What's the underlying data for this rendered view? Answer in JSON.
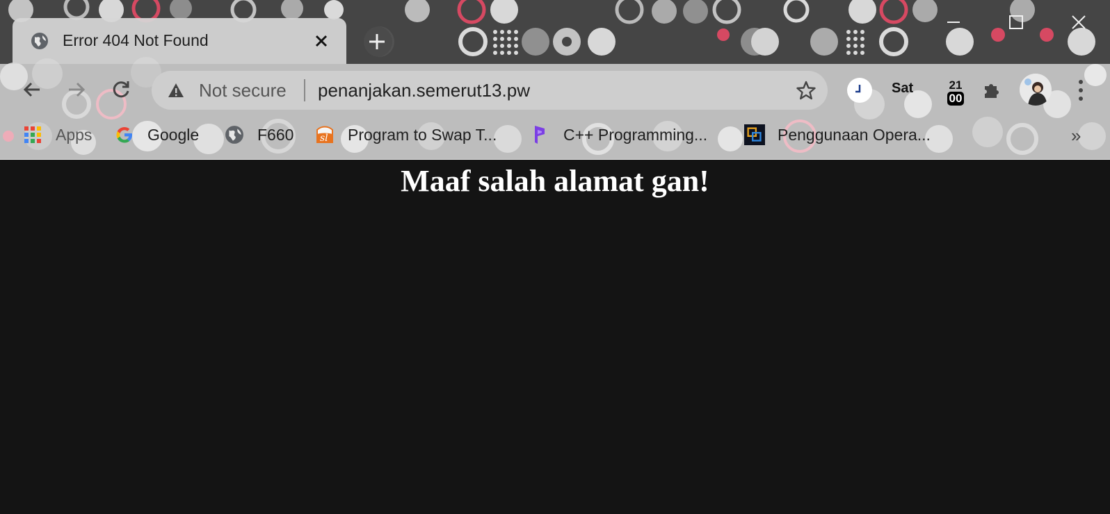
{
  "window": {
    "icons": {
      "minimize": "minimize-icon",
      "maximize": "maximize-icon",
      "close": "close-icon"
    }
  },
  "tab": {
    "title": "Error 404 Not Found",
    "favicon": "globe-icon",
    "close_icon": "close-icon"
  },
  "new_tab_icon": "plus-icon",
  "nav": {
    "back_icon": "back-arrow-icon",
    "forward_icon": "forward-arrow-icon",
    "reload_icon": "reload-icon"
  },
  "omnibox": {
    "security_icon": "warning-triangle-icon",
    "security_label": "Not secure",
    "url": "penanjakan.semerut13.pw",
    "bookmark_icon": "star-icon"
  },
  "extensions": {
    "clock_icon": "clock-icon",
    "day": "Sat",
    "date_number": "21",
    "date_box": "00",
    "puzzle_icon": "puzzle-icon",
    "avatar": "profile-avatar",
    "menu_icon": "three-dots-icon"
  },
  "bookmarks": [
    {
      "label": "Apps",
      "icon": "apps-grid-icon"
    },
    {
      "label": "Google",
      "icon": "google-icon"
    },
    {
      "label": "F660",
      "icon": "globe-icon"
    },
    {
      "label": "Program to Swap T...",
      "icon": "sl-logo-icon"
    },
    {
      "label": "C++ Programming...",
      "icon": "p-logo-icon"
    },
    {
      "label": "Penggunaan Opera...",
      "icon": "app-logo-icon"
    }
  ],
  "bookmarks_overflow": "»",
  "page": {
    "heading": "Maaf salah alamat gan!",
    "background": "#141414"
  },
  "colors": {
    "theme_pink": "#f04a68",
    "titlebar": "#454545",
    "toolbar": "#bdbdbd"
  }
}
